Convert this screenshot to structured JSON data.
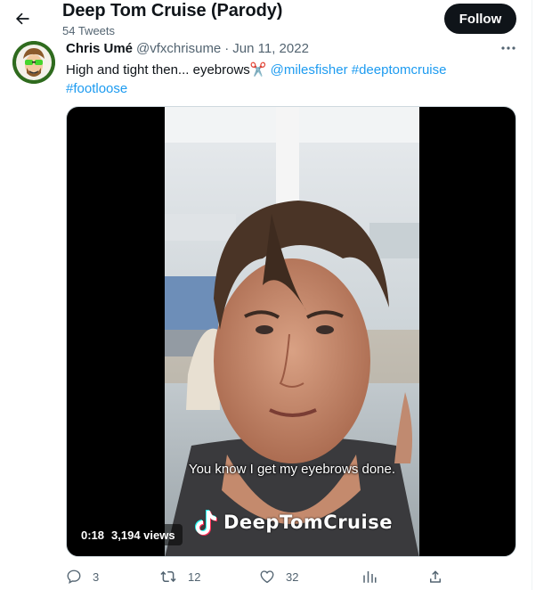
{
  "header": {
    "title": "Deep Tom Cruise (Parody)",
    "tweets_count": "54 Tweets",
    "follow_label": "Follow"
  },
  "tweet": {
    "display_name": "Chris Umé",
    "handle": "@vfxchrisume",
    "separator": "·",
    "date": "Jun 11, 2022",
    "text": "High and tight then... eyebrows",
    "emoji": "✂️",
    "mention": "@milesfisher",
    "hashtags": [
      "#deeptomcruise",
      "#footloose"
    ]
  },
  "video": {
    "caption": "You know I get my eyebrows done.",
    "watermark": "DeepTomCruise",
    "duration": "0:18",
    "views": "3,194 views"
  },
  "actions": {
    "replies": "3",
    "retweets": "12",
    "likes": "32"
  },
  "colors": {
    "link": "#1d9bf0",
    "muted": "#536471",
    "text": "#0f1419",
    "follow_bg": "#0f1419"
  },
  "icons": [
    "back-arrow-icon",
    "more-icon",
    "reply-icon",
    "retweet-icon",
    "like-icon",
    "analytics-icon",
    "share-icon"
  ]
}
